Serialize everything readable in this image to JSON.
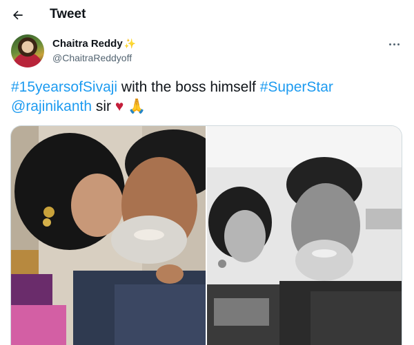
{
  "header": {
    "title": "Tweet",
    "back_icon": "arrow-left-icon"
  },
  "tweet": {
    "author": {
      "name": "Chaitra Reddy",
      "name_emoji": "✨",
      "handle": "@ChaitraReddyoff"
    },
    "text": {
      "hashtag1": "#15yearsofSivaji",
      "plain1": " with the boss himself ",
      "hashtag2": "#SuperStar",
      "mention": "@rajinikanth",
      "plain2": " sir ",
      "emoji_heart": "♥",
      "emoji_pray": "🙏"
    },
    "media": [
      {
        "description_icon": "photo-color"
      },
      {
        "description_icon": "photo-bw"
      }
    ]
  },
  "colors": {
    "link": "#1d9bf0",
    "text": "#0f1419",
    "secondary": "#536471",
    "border": "#cfd9de"
  }
}
